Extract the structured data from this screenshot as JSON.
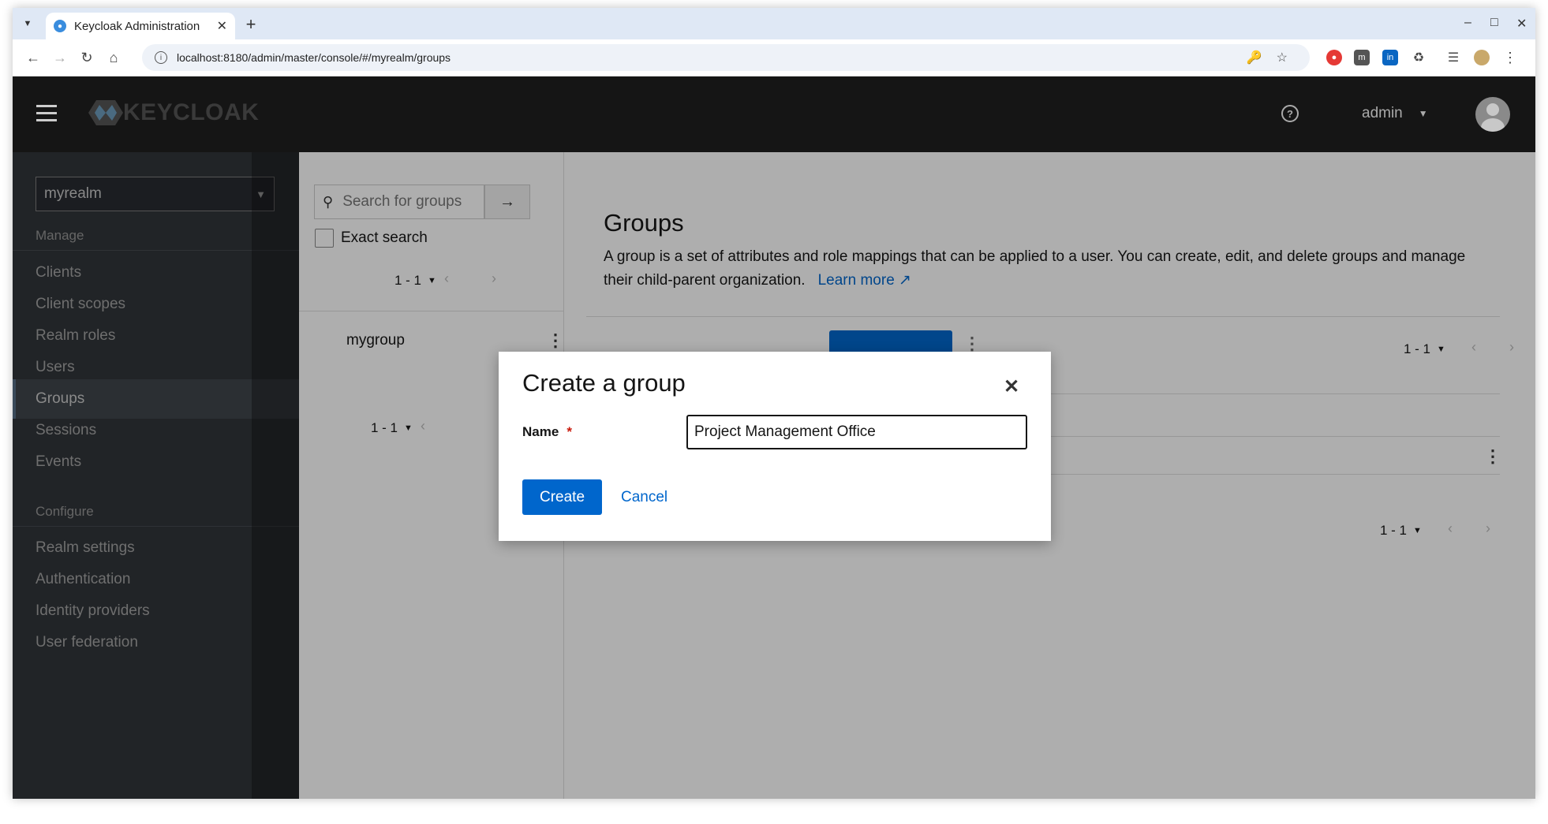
{
  "browser": {
    "tab_title": "Keycloak Administration",
    "url": "localhost:8180/admin/master/console/#/myrealm/groups"
  },
  "header": {
    "brand": "KEYCLOAK",
    "username": "admin"
  },
  "sidebar": {
    "realm": "myrealm",
    "manage_label": "Manage",
    "manage_items": [
      {
        "label": "Clients"
      },
      {
        "label": "Client scopes"
      },
      {
        "label": "Realm roles"
      },
      {
        "label": "Users"
      },
      {
        "label": "Groups",
        "active": true
      },
      {
        "label": "Sessions"
      },
      {
        "label": "Events"
      }
    ],
    "configure_label": "Configure",
    "configure_items": [
      {
        "label": "Realm settings"
      },
      {
        "label": "Authentication"
      },
      {
        "label": "Identity providers"
      },
      {
        "label": "User federation"
      }
    ]
  },
  "tree": {
    "search_placeholder": "Search for groups",
    "exact_search_label": "Exact search",
    "pager_top": "1 - 1",
    "pager_bottom": "1 - 1",
    "groups": [
      "mygroup"
    ]
  },
  "main": {
    "title": "Groups",
    "description": "A group is a set of attributes and role mappings that can be applied to a user. You can create, edit, and delete groups and manage their child-parent organization.",
    "learn_more": "Learn more",
    "pager_top": "1 - 1",
    "pager_bottom": "1 - 1"
  },
  "modal": {
    "title": "Create a group",
    "name_label": "Name",
    "required_mark": "*",
    "name_value": "Project Management Office",
    "create_label": "Create",
    "cancel_label": "Cancel"
  },
  "colors": {
    "primary": "#0066cc",
    "header_bg": "#151515",
    "sidebar_bg": "#212427"
  }
}
